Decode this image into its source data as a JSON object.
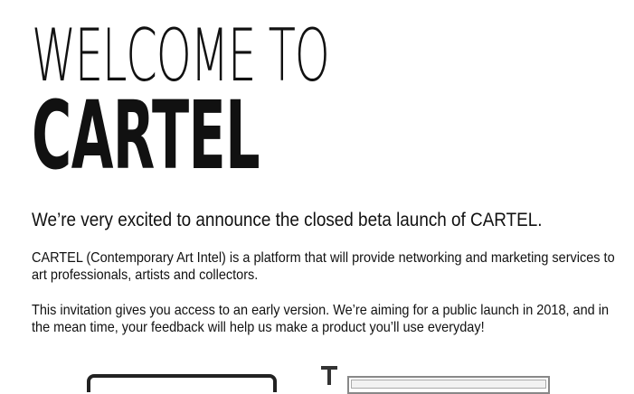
{
  "hero": {
    "welcome_line": "WELCOME TO",
    "brand_name": "CARTEL"
  },
  "intro": {
    "headline": "We’re very excited to announce the closed beta launch of CARTEL.",
    "paragraph_1": "CARTEL (Contemporary Art Intel) is a platform that will provide networking and marketing services to art professionals, artists and collectors.",
    "paragraph_2": "This invitation gives you access to an early version. We’re aiming for a public launch in 2018, and in the mean time, your feedback will help us make a product you’ll use everyday!"
  },
  "images": {
    "laptop_icon": "laptop-illustration",
    "stand_icon": "stand-illustration",
    "screen_icon": "screen-illustration"
  }
}
